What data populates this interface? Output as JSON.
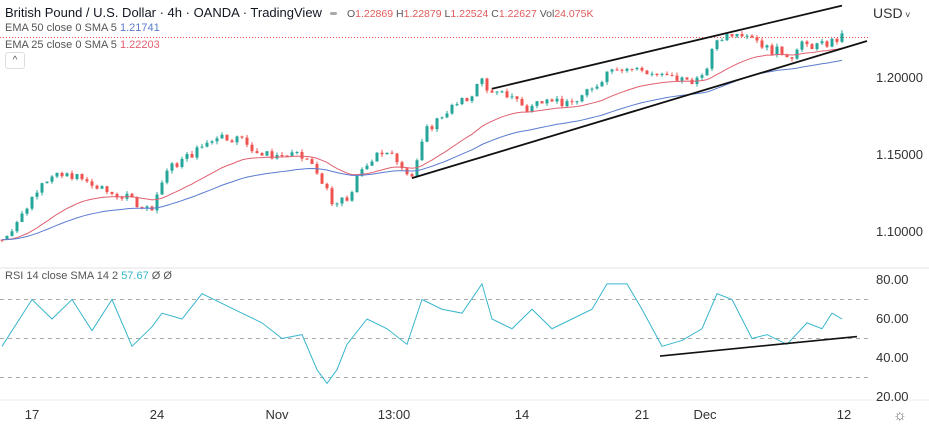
{
  "header": {
    "title": "British Pound / U.S. Dollar · 4h · OANDA · TradingView",
    "o_label": "O",
    "o": "1.22869",
    "h_label": "H",
    "h": "1.22879",
    "l_label": "L",
    "l": "1.22524",
    "c_label": "C",
    "c": "1.22627",
    "vol_label": "Vol",
    "vol": "24.075K"
  },
  "indicators": {
    "ema50_label": "EMA 50 close 0 SMA 5",
    "ema50_value": "1.21741",
    "ema25_label": "EMA 25 close 0 SMA 5",
    "ema25_value": "1.22203",
    "rsi_label": "RSI 14 close SMA 14 2",
    "rsi_value": "57.67",
    "rsi_extra1": "Ø",
    "rsi_extra2": "Ø",
    "collapse_icon": "^"
  },
  "currency": "USD",
  "colors": {
    "up": "#26a69a",
    "down": "#ef5350",
    "ema25": "#e06070",
    "ema50": "#5b7bd0",
    "rsi": "#39b6cc"
  },
  "chart_data": [
    {
      "type": "candlestick",
      "title": "British Pound / U.S. Dollar 4h",
      "ylim": [
        1.085,
        1.255
      ],
      "y_ticks": [
        "1.20000",
        "1.15000",
        "1.10000"
      ],
      "y_tick_values": [
        1.2,
        1.15,
        1.1
      ],
      "x_ticks": [
        {
          "label": "17",
          "bar": 6
        },
        {
          "label": "24",
          "bar": 31
        },
        {
          "label": "Nov",
          "bar": 55
        },
        {
          "label": "13:00",
          "bar": 78.4
        },
        {
          "label": "14",
          "bar": 104
        },
        {
          "label": "21",
          "bar": 128
        },
        {
          "label": "Dec",
          "bar": 140.6
        },
        {
          "label": "12",
          "bar": 168.4
        }
      ],
      "close_path": [
        [
          0,
          1.095
        ],
        [
          4,
          1.111
        ],
        [
          8,
          1.134
        ],
        [
          14,
          1.137
        ],
        [
          20,
          1.127
        ],
        [
          26,
          1.121
        ],
        [
          29.6,
          1.114
        ],
        [
          33,
          1.14
        ],
        [
          39,
          1.153
        ],
        [
          43,
          1.163
        ],
        [
          48,
          1.16
        ],
        [
          52,
          1.15
        ],
        [
          58,
          1.15
        ],
        [
          61,
          1.147
        ],
        [
          64,
          1.134
        ],
        [
          66,
          1.117
        ],
        [
          69,
          1.121
        ],
        [
          71,
          1.134
        ],
        [
          75,
          1.153
        ],
        [
          79,
          1.147
        ],
        [
          82,
          1.137
        ],
        [
          85,
          1.166
        ],
        [
          89,
          1.179
        ],
        [
          93,
          1.186
        ],
        [
          96,
          1.199
        ],
        [
          98,
          1.189
        ],
        [
          102,
          1.189
        ],
        [
          105,
          1.179
        ],
        [
          109,
          1.189
        ],
        [
          113,
          1.182
        ],
        [
          118,
          1.192
        ],
        [
          122,
          1.208
        ],
        [
          128,
          1.205
        ],
        [
          132,
          1.201
        ],
        [
          136,
          1.199
        ],
        [
          140,
          1.199
        ],
        [
          143,
          1.225
        ],
        [
          147,
          1.231
        ],
        [
          150,
          1.228
        ],
        [
          153,
          1.219
        ],
        [
          158,
          1.215
        ],
        [
          160,
          1.221
        ],
        [
          164,
          1.221
        ],
        [
          168,
          1.2263
        ]
      ],
      "last_price": 1.22627,
      "trendlines": [
        [
          [
            98,
            1.193
          ],
          [
            168,
            1.247
          ]
        ],
        [
          [
            82,
            1.135
          ],
          [
            173,
            1.224
          ]
        ]
      ]
    },
    {
      "type": "line",
      "title": "RSI 14",
      "ylim": [
        15,
        85
      ],
      "y_ticks": [
        "80.00",
        "60.00",
        "40.00",
        "20.00"
      ],
      "y_tick_values": [
        80,
        60,
        40,
        20
      ],
      "bands": [
        70,
        50,
        30
      ],
      "points": [
        [
          0,
          46
        ],
        [
          6,
          70
        ],
        [
          10,
          60
        ],
        [
          14,
          70
        ],
        [
          18,
          54
        ],
        [
          22,
          70
        ],
        [
          26,
          46
        ],
        [
          30,
          56
        ],
        [
          32,
          63
        ],
        [
          36,
          60
        ],
        [
          40,
          73
        ],
        [
          44,
          68
        ],
        [
          48,
          63
        ],
        [
          52,
          58
        ],
        [
          56,
          50
        ],
        [
          60,
          52
        ],
        [
          63,
          34
        ],
        [
          65,
          27
        ],
        [
          67,
          34
        ],
        [
          69,
          47
        ],
        [
          73,
          60
        ],
        [
          77,
          55
        ],
        [
          81,
          47
        ],
        [
          84,
          70
        ],
        [
          88,
          65
        ],
        [
          92,
          63
        ],
        [
          96,
          78
        ],
        [
          98,
          60
        ],
        [
          102,
          55
        ],
        [
          106,
          65
        ],
        [
          110,
          55
        ],
        [
          114,
          60
        ],
        [
          118,
          65
        ],
        [
          121,
          78
        ],
        [
          125,
          78
        ],
        [
          128,
          65
        ],
        [
          132,
          46
        ],
        [
          136,
          49
        ],
        [
          140,
          55
        ],
        [
          143,
          73
        ],
        [
          146,
          70
        ],
        [
          150,
          50
        ],
        [
          153,
          52
        ],
        [
          157,
          47
        ],
        [
          161,
          58
        ],
        [
          164,
          55
        ],
        [
          166,
          63
        ],
        [
          168,
          60
        ]
      ],
      "trendline": [
        [
          131.6,
          41
        ],
        [
          171,
          51
        ]
      ]
    }
  ]
}
